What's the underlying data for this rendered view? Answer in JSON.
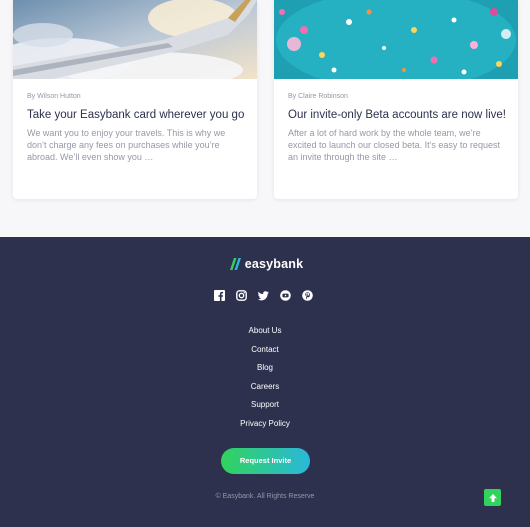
{
  "articles": [
    {
      "byline": "By Wilson Hutton",
      "title": "Take your Easybank card wherever you go",
      "excerpt": "We want you to enjoy your travels. This is why we don’t charge any fees on purchases while you’re abroad. We’ll even show you …",
      "image_icon": "airplane-wing-image"
    },
    {
      "byline": "By Claire Robinson",
      "title": "Our invite-only Beta accounts are now live!",
      "excerpt": "After a lot of hard work by the whole team, we’re excited to launch our closed beta. It’s easy to request an invite through the site …",
      "image_icon": "confetti-image"
    }
  ],
  "footer": {
    "logo_text": "easybank",
    "social_icons": [
      "facebook-icon",
      "instagram-icon",
      "twitter-icon",
      "youtube-icon",
      "pinterest-icon"
    ],
    "links": [
      "About Us",
      "Contact",
      "Blog",
      "Careers",
      "Support",
      "Privacy Policy"
    ],
    "cta_label": "Request Invite",
    "copyright": "© Easybank. All Rights Reserve",
    "scroll_top_icon": "arrow-up-icon"
  },
  "colors": {
    "dark_blue": "#2d314d",
    "lime_green": "#31d35c",
    "bright_cyan": "#2bb7da",
    "grayish_blue": "#9698a6",
    "light_gray": "#f7f7f9"
  }
}
